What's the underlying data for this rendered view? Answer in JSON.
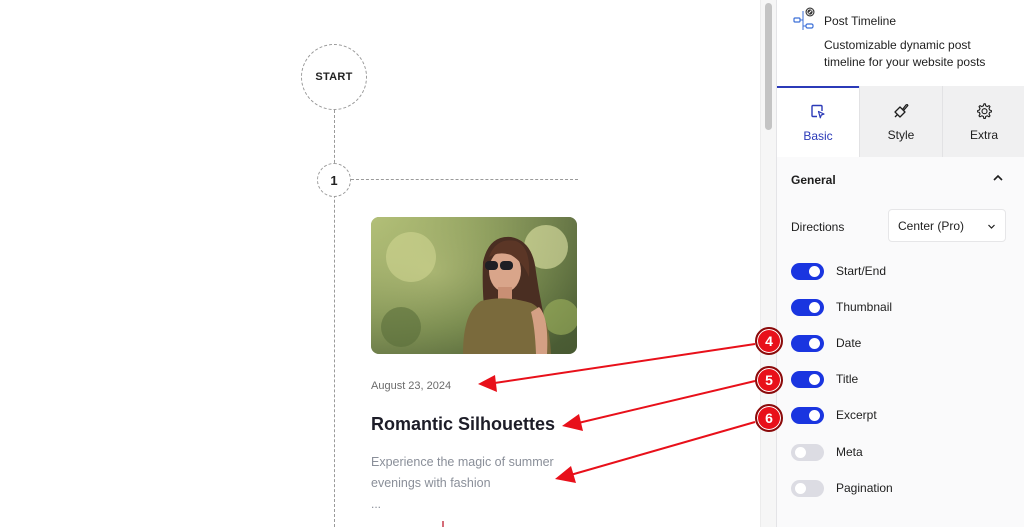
{
  "canvas": {
    "timeline": {
      "start_label": "START",
      "item_number": "1"
    },
    "post": {
      "thumbnail_alt": "woman-wearing-sunglasses-photo",
      "date": "August 23, 2024",
      "title": "Romantic Silhouettes",
      "excerpt": "Experience the magic of summer evenings with fashion",
      "more": "..."
    }
  },
  "panel": {
    "block": {
      "title": "Post Timeline",
      "description": "Customizable dynamic post timeline for your website posts",
      "icon": "timeline-icon"
    },
    "tabs": [
      {
        "label": "Basic",
        "icon": "pointer-select-icon",
        "active": true
      },
      {
        "label": "Style",
        "icon": "brush-icon",
        "active": false
      },
      {
        "label": "Extra",
        "icon": "gear-icon",
        "active": false
      }
    ],
    "section": {
      "title": "General",
      "expanded": true,
      "directions": {
        "label": "Directions",
        "value": "Center (Pro)"
      },
      "toggles": [
        {
          "label": "Start/End",
          "on": true
        },
        {
          "label": "Thumbnail",
          "on": true
        },
        {
          "label": "Date",
          "on": true
        },
        {
          "label": "Title",
          "on": true
        },
        {
          "label": "Excerpt",
          "on": true
        },
        {
          "label": "Meta",
          "on": false
        },
        {
          "label": "Pagination",
          "on": false
        }
      ]
    }
  },
  "annotations": [
    {
      "number": "4",
      "target": "Date"
    },
    {
      "number": "5",
      "target": "Title"
    },
    {
      "number": "6",
      "target": "Excerpt"
    }
  ],
  "colors": {
    "accent": "#1a35e0",
    "tab_active": "#2b3ab8",
    "annotation": "#e8101a"
  }
}
